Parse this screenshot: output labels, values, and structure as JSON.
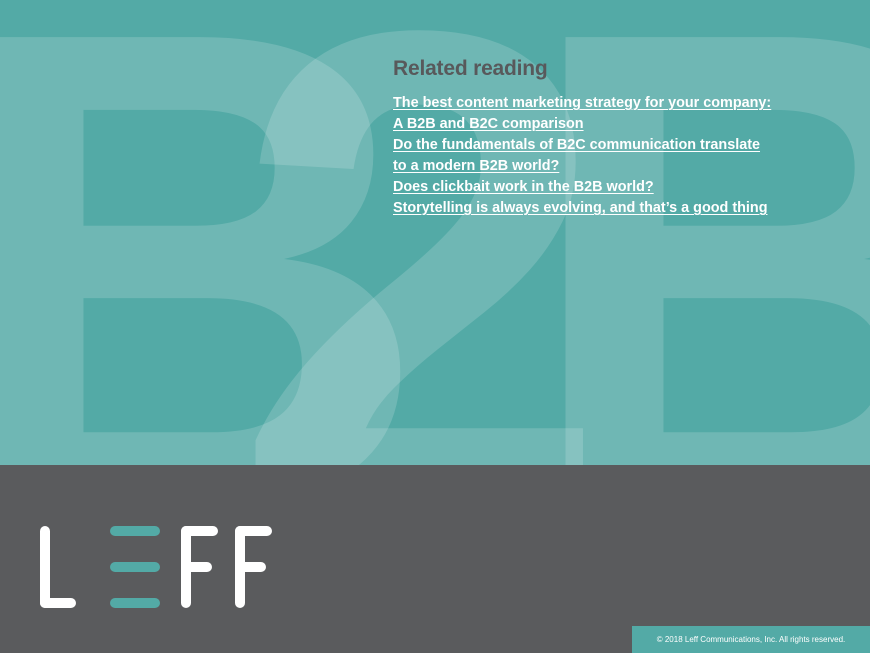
{
  "background": {
    "letters": "B2B"
  },
  "related": {
    "heading": "Related reading",
    "links": [
      {
        "line1": "The best content marketing strategy for your company:",
        "line2": "A B2B and B2C comparison"
      },
      {
        "line1": "Do the fundamentals of B2C communication translate",
        "line2": "to a modern B2B world?"
      },
      {
        "line1": "Does clickbait work in the B2B world?",
        "line2": ""
      },
      {
        "line1": "Storytelling is always evolving, and that’s a good thing",
        "line2": ""
      }
    ]
  },
  "footer": {
    "copyright": "© 2018 Leff Communications, Inc. All rights reserved."
  },
  "colors": {
    "teal": "#53aaa6",
    "gray": "#5a5b5d",
    "heading": "#58595b",
    "white": "#ffffff"
  },
  "logo": {
    "icon": "leff-logo"
  }
}
